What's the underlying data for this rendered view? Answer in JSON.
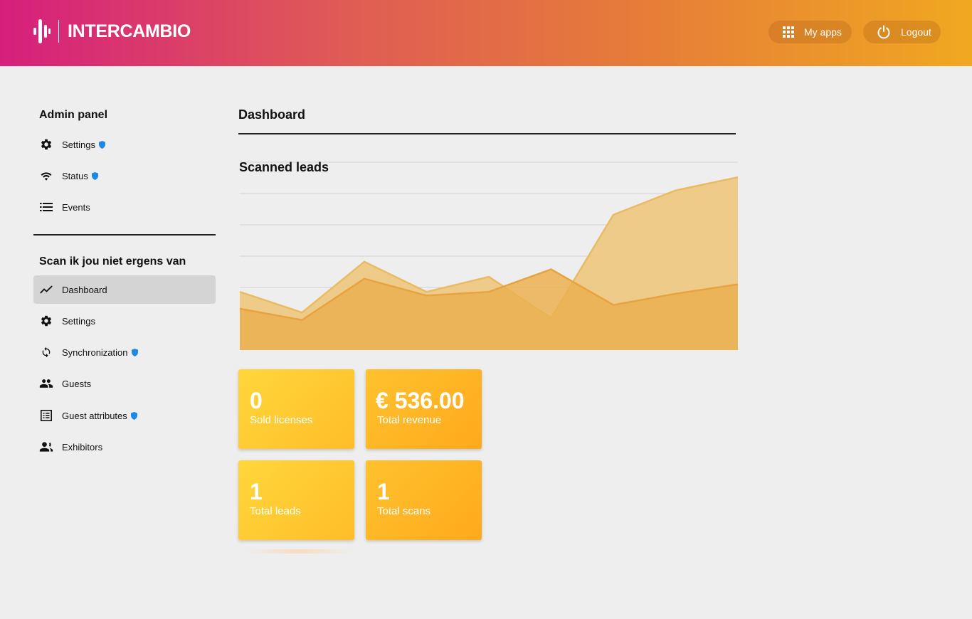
{
  "header": {
    "brand": "INTERCAMBIO",
    "myapps_label": "My apps",
    "logout_label": "Logout"
  },
  "sidebar": {
    "admin_title": "Admin panel",
    "admin_items": [
      {
        "label": "Settings",
        "icon": "gear-icon",
        "badge": true
      },
      {
        "label": "Status",
        "icon": "wifi-icon",
        "badge": true
      },
      {
        "label": "Events",
        "icon": "list-icon",
        "badge": false
      }
    ],
    "event_title": "Scan ik jou niet ergens van",
    "event_items": [
      {
        "label": "Dashboard",
        "icon": "trending-icon",
        "badge": false,
        "active": true
      },
      {
        "label": "Settings",
        "icon": "gear-icon",
        "badge": false
      },
      {
        "label": "Synchronization",
        "icon": "sync-icon",
        "badge": true
      },
      {
        "label": "Guests",
        "icon": "people-icon",
        "badge": false
      },
      {
        "label": "Guest attributes",
        "icon": "table-icon",
        "badge": true
      },
      {
        "label": "Exhibitors",
        "icon": "exhibitors-icon",
        "badge": false
      }
    ]
  },
  "main": {
    "title": "Dashboard"
  },
  "cards": [
    {
      "value": "0",
      "label": "Sold licenses"
    },
    {
      "value": "€ 536.00",
      "label": "Total revenue"
    },
    {
      "value": "1",
      "label": "Total leads"
    },
    {
      "value": "1",
      "label": "Total scans"
    }
  ],
  "colors": {
    "accent_badge": "#1e88e5",
    "area_back": "#eec77d",
    "area_front": "#ebb050"
  },
  "chart_data": {
    "type": "area",
    "title": "Scanned leads",
    "x": [
      0,
      1,
      2,
      3,
      4,
      5,
      6,
      7,
      8
    ],
    "series": [
      {
        "values": [
          0.31,
          0.2,
          0.47,
          0.31,
          0.39,
          0.17,
          0.72,
          0.85,
          0.92
        ]
      },
      {
        "values": [
          0.22,
          0.16,
          0.38,
          0.29,
          0.31,
          0.43,
          0.24,
          0.3,
          0.35
        ]
      }
    ],
    "ylim": [
      0,
      1
    ],
    "grid": true
  }
}
